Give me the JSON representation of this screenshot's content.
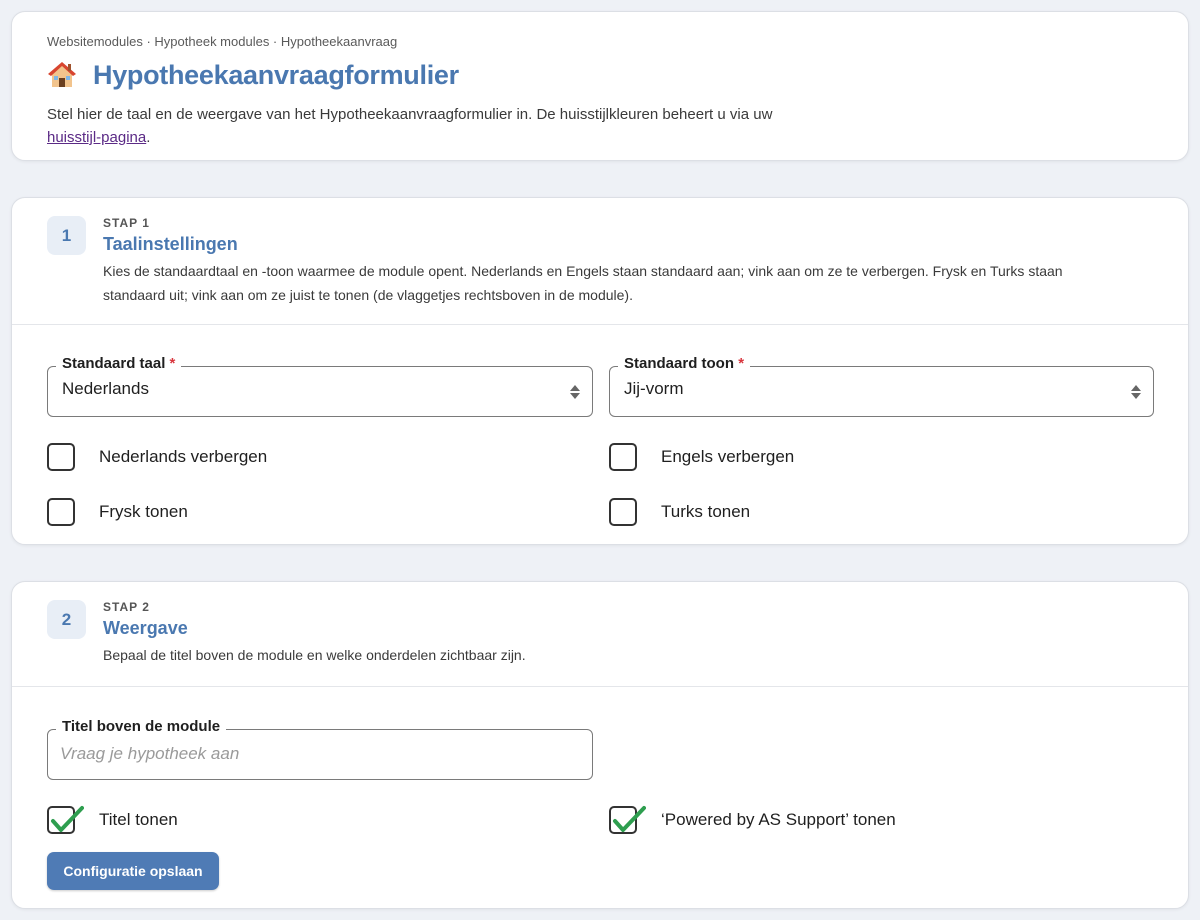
{
  "header": {
    "breadcrumb": "Websitemodules · Hypotheek modules · Hypotheekaanvraag",
    "title": "Hypotheekaanvraagformulier",
    "intro_text": "Stel hier de taal en de weergave van het Hypotheekaanvraagformulier in. De huisstijlkleuren beheert u via uw ",
    "intro_link": "huisstijl-pagina",
    "intro_end": "."
  },
  "step1": {
    "number": "1",
    "kicker": "STAP 1",
    "title": "Taalinstellingen",
    "description": "Kies de standaardtaal en -toon waarmee de module opent. Nederlands en Engels staan standaard aan; vink aan om ze te verbergen. Frysk en Turks staan standaard uit; vink aan om ze juist te tonen (de vlaggetjes rechtsboven in de module).",
    "default_language": {
      "label": "Standaard taal",
      "required": "*",
      "value": "Nederlands"
    },
    "default_tone": {
      "label": "Standaard toon",
      "required": "*",
      "value": "Jij-vorm"
    },
    "checkboxes": [
      {
        "label": "Nederlands verbergen",
        "checked": false
      },
      {
        "label": "Engels verbergen",
        "checked": false
      },
      {
        "label": "Frysk tonen",
        "checked": false
      },
      {
        "label": "Turks tonen",
        "checked": false
      }
    ]
  },
  "step2": {
    "number": "2",
    "kicker": "STAP 2",
    "title": "Weergave",
    "description": "Bepaal de titel boven de module en welke onderdelen zichtbaar zijn.",
    "module_title": {
      "label": "Titel boven de module",
      "placeholder": "Vraag je hypotheek aan",
      "value": ""
    },
    "checkboxes": [
      {
        "label": "Titel tonen",
        "checked": true
      },
      {
        "label": "‘Powered by AS Support’ tonen",
        "checked": true
      }
    ],
    "save_label": "Configuratie opslaan"
  },
  "colors": {
    "accent": "#4a78b0",
    "button": "#4f7bb5",
    "check": "#2e9e4f",
    "link": "#5b2a86",
    "required": "#d9363e"
  }
}
